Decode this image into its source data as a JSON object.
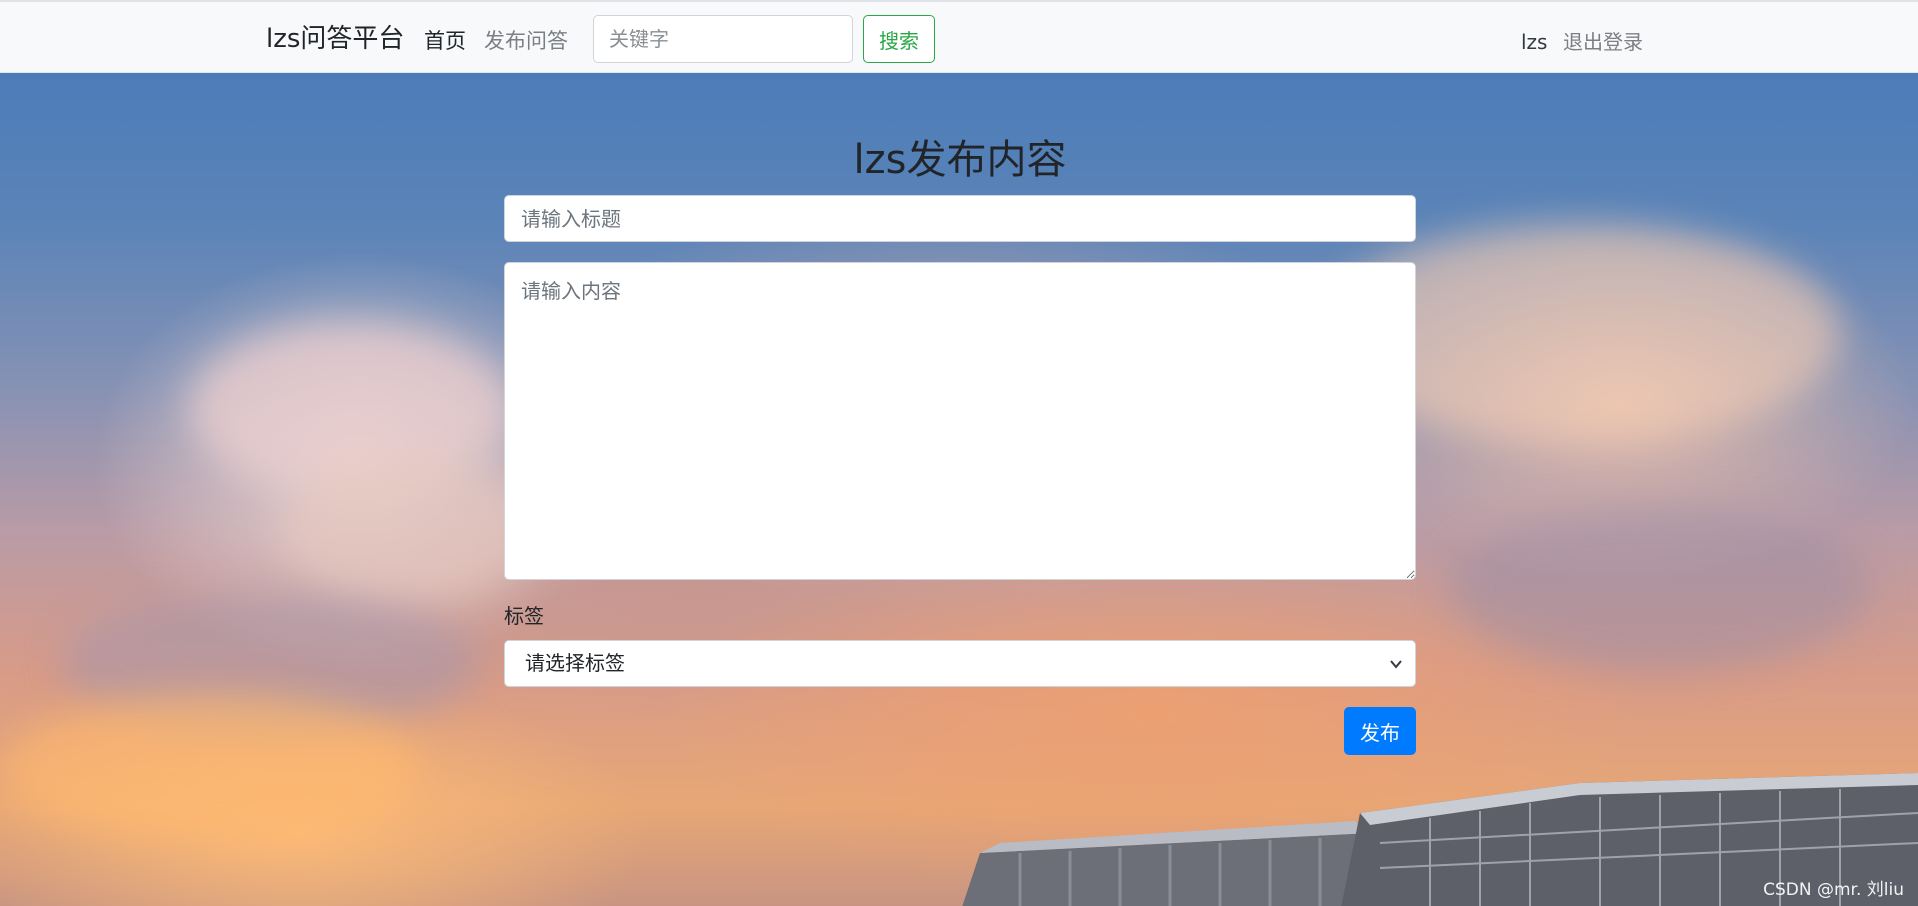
{
  "navbar": {
    "brand": "lzs问答平台",
    "home": "首页",
    "publish": "发布问答",
    "search_placeholder": "关键字",
    "search_button": "搜索",
    "username": "lzs",
    "logout": "退出登录"
  },
  "form": {
    "heading": "lzs发布内容",
    "title_placeholder": "请输入标题",
    "content_placeholder": "请输入内容",
    "tag_label": "标签",
    "tag_selected": "请选择标签",
    "submit_button": "发布"
  },
  "watermark": "CSDN @mr. 刘liu",
  "colors": {
    "search_button": "#28a745",
    "primary": "#007bff",
    "navbar_bg": "#f8f9fa"
  }
}
